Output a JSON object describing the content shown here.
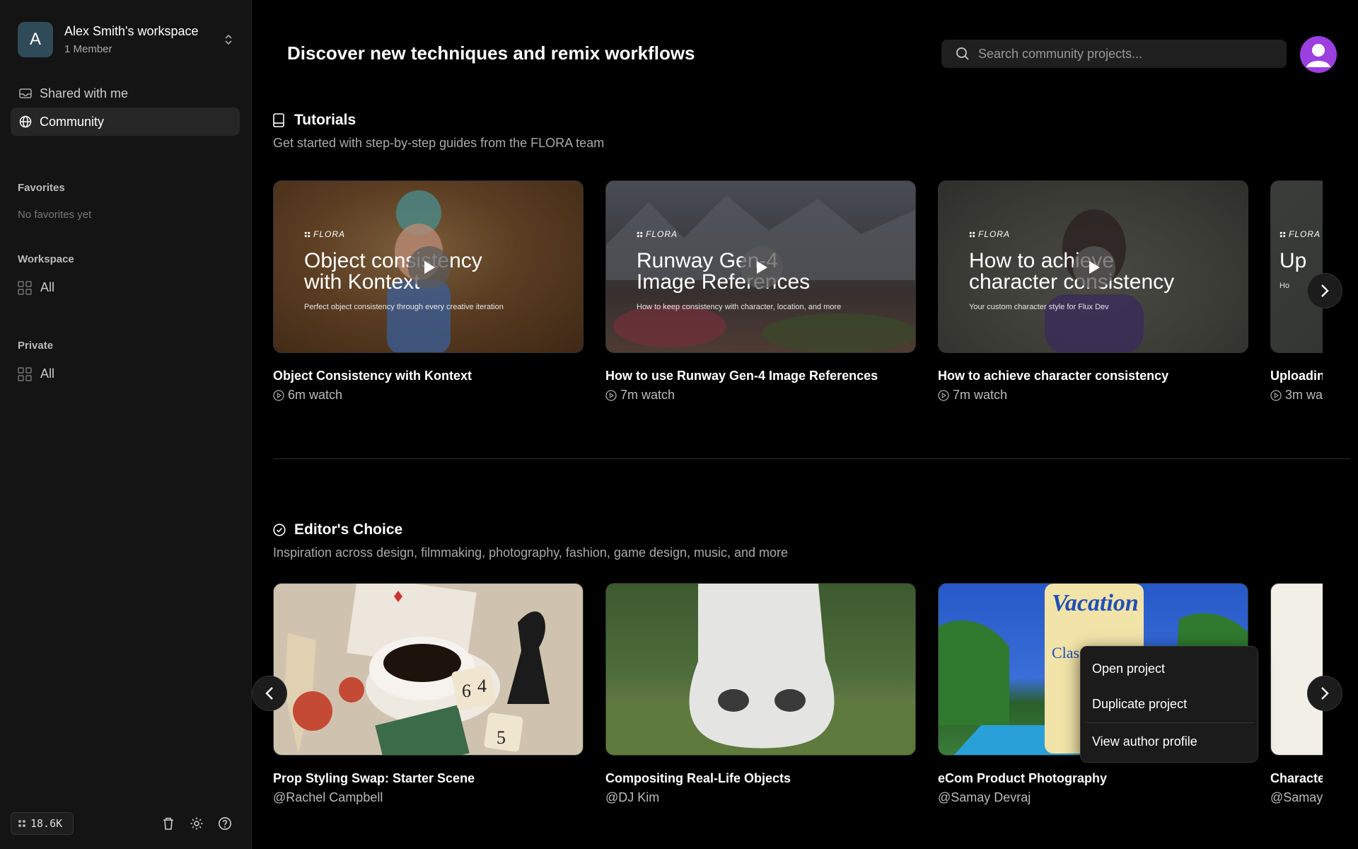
{
  "sidebar": {
    "workspace": {
      "initial": "A",
      "name": "Alex Smith's workspace",
      "members": "1 Member"
    },
    "nav": [
      {
        "label": "Shared with me"
      },
      {
        "label": "Community"
      }
    ],
    "favorites": {
      "label": "Favorites",
      "empty": "No favorites yet"
    },
    "workspace_section": {
      "label": "Workspace",
      "item": "All"
    },
    "private_section": {
      "label": "Private",
      "item": "All"
    },
    "credits": "18.6K"
  },
  "header": {
    "title": "Discover new techniques and remix workflows",
    "search_placeholder": "Search community projects..."
  },
  "tutorials": {
    "title": "Tutorials",
    "subtitle": "Get started with step-by-step guides from the FLORA team",
    "cards": [
      {
        "brand": "FLORA",
        "head1": "Object consistency",
        "head2": "with Kontext",
        "sub": "Perfect object consistency through every creative iteration",
        "title": "Object Consistency with Kontext",
        "meta": "6m watch"
      },
      {
        "brand": "FLORA",
        "head1": "Runway Gen-4",
        "head2": "Image References",
        "sub": "How to keep consistency with character, location, and more",
        "title": "How to use Runway Gen-4 Image References",
        "meta": "7m watch"
      },
      {
        "brand": "FLORA",
        "head1": "How to achieve",
        "head2": "character consistency",
        "sub": "Your custom character style for Flux Dev",
        "title": "How to achieve character consistency",
        "meta": "7m watch"
      },
      {
        "brand": "FLORA",
        "head1": "Up",
        "head2": "",
        "sub": "Ho",
        "title": "Uploading",
        "meta": "3m wa"
      }
    ]
  },
  "editors_choice": {
    "title": "Editor's Choice",
    "subtitle": "Inspiration across design, filmmaking, photography, fashion, game design, music, and more",
    "cards": [
      {
        "title": "Prop Styling Swap: Starter Scene",
        "author": "@Rachel Campbell"
      },
      {
        "title": "Compositing Real-Life Objects",
        "author": "@DJ Kim"
      },
      {
        "title": "eCom Product Photography",
        "author": "@Samay Devraj"
      },
      {
        "title": "Character",
        "author": "@Samay"
      }
    ],
    "product_brand": "Vacation",
    "product_text": "Classic",
    "dice": [
      "6",
      "4",
      "5"
    ]
  },
  "context_menu": {
    "items": [
      "Open project",
      "Duplicate project",
      "View author profile"
    ]
  }
}
